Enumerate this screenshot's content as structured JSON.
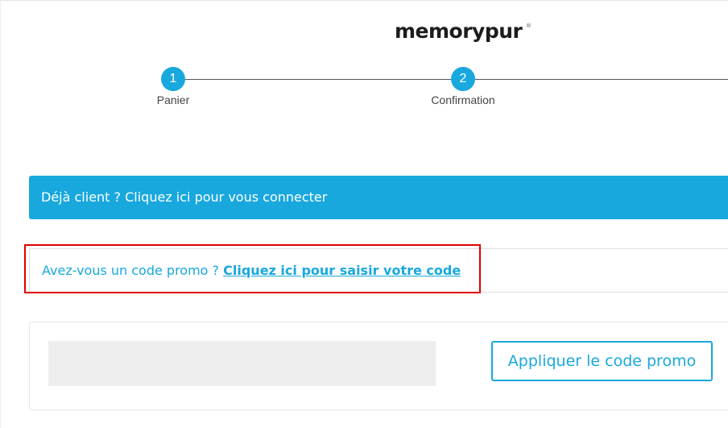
{
  "brand": {
    "logo_text": "memorypur",
    "registered_mark": "®",
    "accent_color": "#18a8de"
  },
  "steps": [
    {
      "number": "1",
      "label": "Panier"
    },
    {
      "number": "2",
      "label": "Confirmation"
    }
  ],
  "login": {
    "text": "Déjà client ? Cliquez ici pour vous connecter"
  },
  "promo": {
    "question": "Avez-vous un code promo ?",
    "link_text": "Cliquez ici pour saisir votre code",
    "input_value": "",
    "input_placeholder": "",
    "apply_label": "Appliquer le code promo"
  },
  "colors": {
    "highlight": "#e00000",
    "banner": "#18a8de"
  }
}
